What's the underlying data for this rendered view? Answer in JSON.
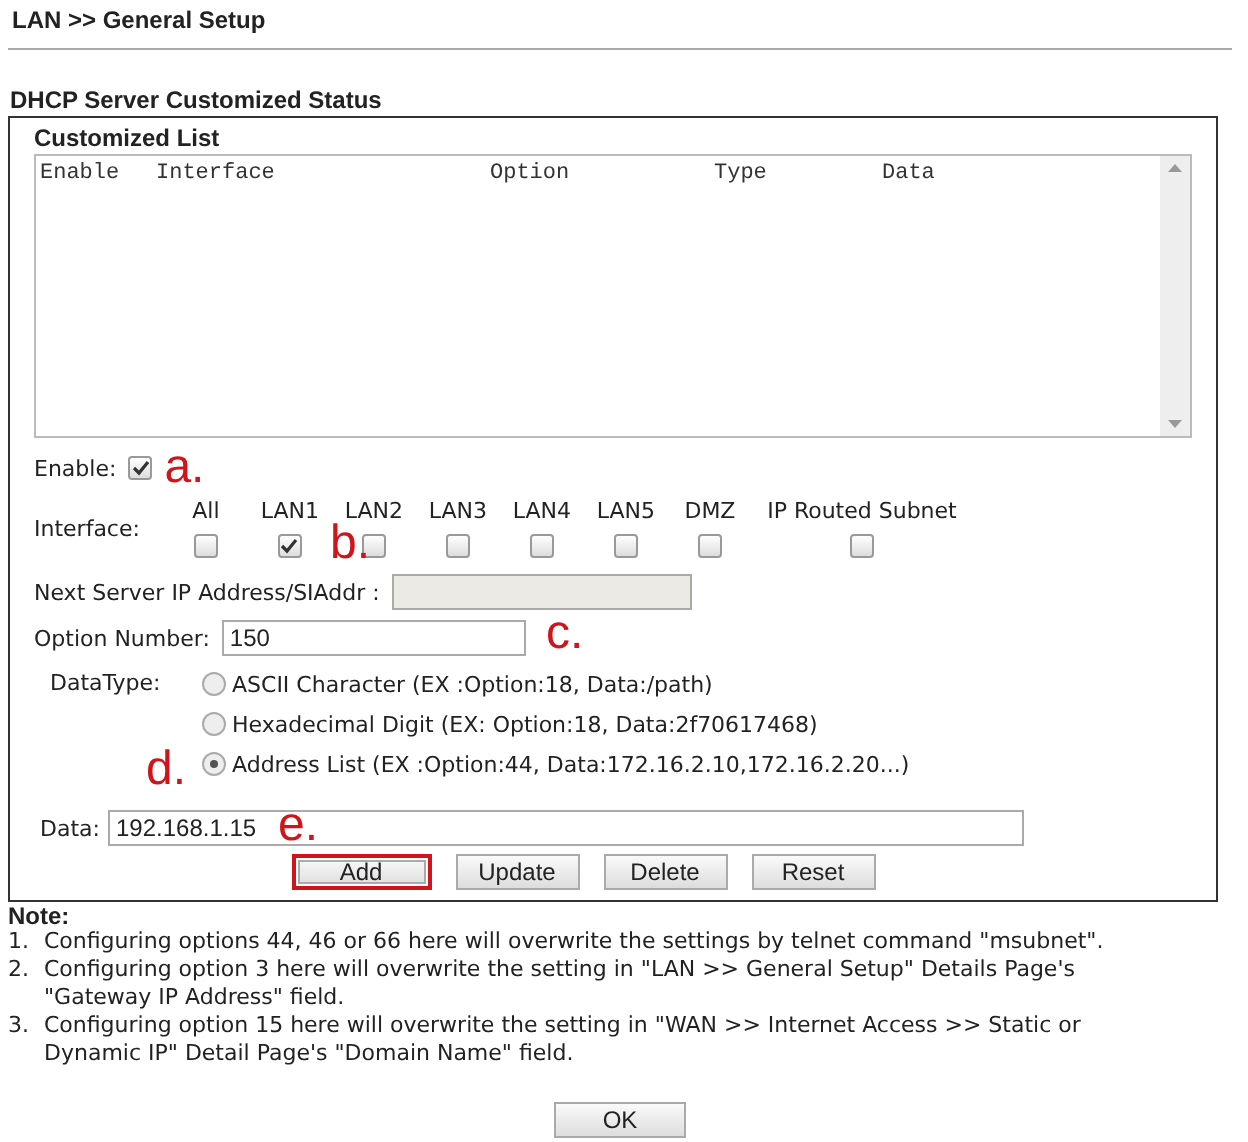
{
  "header": {
    "title": "LAN >> General Setup"
  },
  "section_title": "DHCP Server Customized Status",
  "customized_list": {
    "title": "Customized List",
    "columns": [
      "Enable",
      "Interface",
      "Option",
      "Type",
      "Data"
    ]
  },
  "enable": {
    "label": "Enable:",
    "checked": true,
    "annotation": "a."
  },
  "interface": {
    "label": "Interface:",
    "annotation": "b.",
    "options": [
      {
        "label": "All",
        "checked": false
      },
      {
        "label": "LAN1",
        "checked": true
      },
      {
        "label": "LAN2",
        "checked": false
      },
      {
        "label": "LAN3",
        "checked": false
      },
      {
        "label": "LAN4",
        "checked": false
      },
      {
        "label": "LAN5",
        "checked": false
      },
      {
        "label": "DMZ",
        "checked": false
      },
      {
        "label": "IP Routed Subnet",
        "checked": false
      }
    ]
  },
  "next_server": {
    "label": "Next Server IP Address/SIAddr :",
    "disabled": true
  },
  "option_number": {
    "label": "Option Number:",
    "value": "150",
    "annotation": "c."
  },
  "data_type": {
    "label": "DataType:",
    "annotation": "d.",
    "options": [
      {
        "label": "ASCII Character (EX :Option:18, Data:/path)",
        "selected": false
      },
      {
        "label": "Hexadecimal Digit (EX: Option:18, Data:2f70617468)",
        "selected": false
      },
      {
        "label": "Address List (EX :Option:44, Data:172.16.2.10,172.16.2.20...)",
        "selected": true
      }
    ]
  },
  "data": {
    "label": "Data:",
    "value": "192.168.1.15",
    "annotation": "e."
  },
  "buttons": [
    {
      "label": "Add",
      "highlighted": true
    },
    {
      "label": "Update",
      "highlighted": false
    },
    {
      "label": "Delete",
      "highlighted": false
    },
    {
      "label": "Reset",
      "highlighted": false
    }
  ],
  "notes": {
    "title": "Note:",
    "items": [
      {
        "number": "1.",
        "text": "Configuring options 44, 46 or 66 here will overwrite the settings by telnet command \"msubnet\"."
      },
      {
        "number": "2.",
        "text": "Configuring option 3 here will overwrite the setting in \"LAN >> General Setup\" Details Page's \"Gateway IP Address\" field."
      },
      {
        "number": "3.",
        "text": "Configuring option 15 here will overwrite the setting in \"WAN >> Internet Access >> Static or Dynamic IP\" Detail Page's \"Domain Name\" field."
      }
    ]
  },
  "ok_button": "OK"
}
